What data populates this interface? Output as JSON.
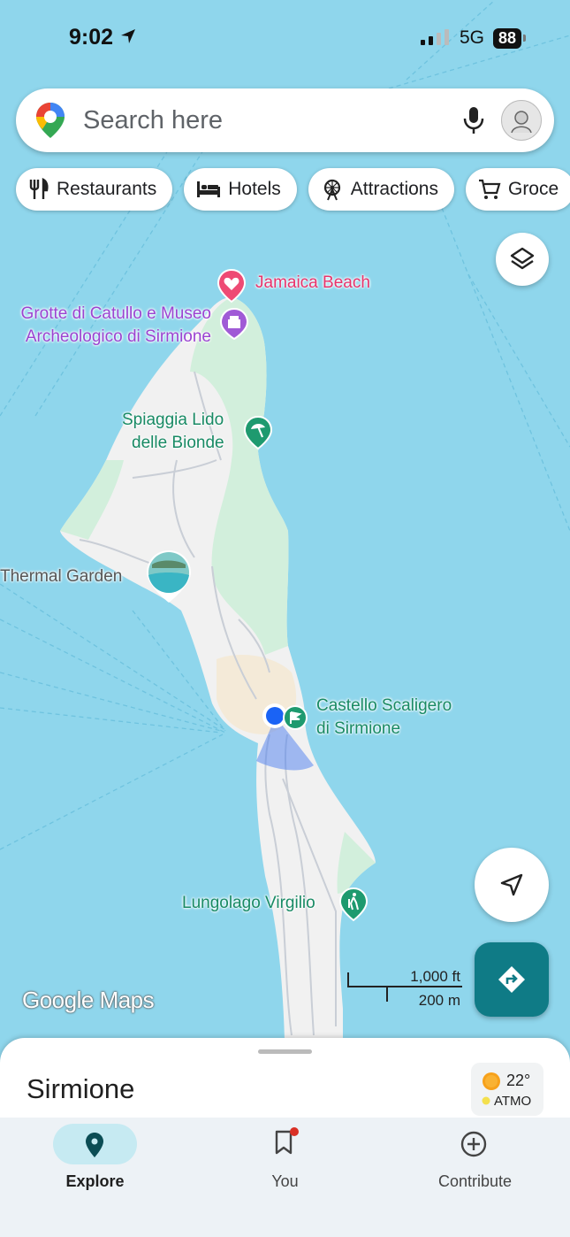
{
  "status_bar": {
    "time": "9:02",
    "network": "5G",
    "battery": "88"
  },
  "search": {
    "placeholder": "Search here"
  },
  "chips": [
    {
      "label": "Restaurants",
      "icon": "fork-knife-icon"
    },
    {
      "label": "Hotels",
      "icon": "bed-icon"
    },
    {
      "label": "Attractions",
      "icon": "ferris-wheel-icon"
    },
    {
      "label": "Groce",
      "icon": "cart-icon"
    }
  ],
  "map_labels": {
    "jamaica_beach": "Jamaica Beach",
    "grotte_1": "Grotte di Catullo e Museo",
    "grotte_2": "Archeologico di Sirmione",
    "spiaggia_1": "Spiaggia Lido",
    "spiaggia_2": "delle Bionde",
    "thermal_garden": "Thermal Garden",
    "castello_1": "Castello Scaligero",
    "castello_2": "di Sirmione",
    "lungolago": "Lungolago Virgilio"
  },
  "map_logo": "Google Maps",
  "scale": {
    "imperial": "1,000 ft",
    "metric": "200 m"
  },
  "sheet": {
    "place_name": "Sirmione",
    "temperature": "22°",
    "air_quality": "ATMO"
  },
  "nav": {
    "explore": "Explore",
    "you": "You",
    "contribute": "Contribute"
  },
  "colors": {
    "water": "#8fd6ec",
    "land": "#f1f1f1",
    "park": "#d2efdc",
    "accent": "#0f7b86",
    "location": "#1a63f5"
  }
}
